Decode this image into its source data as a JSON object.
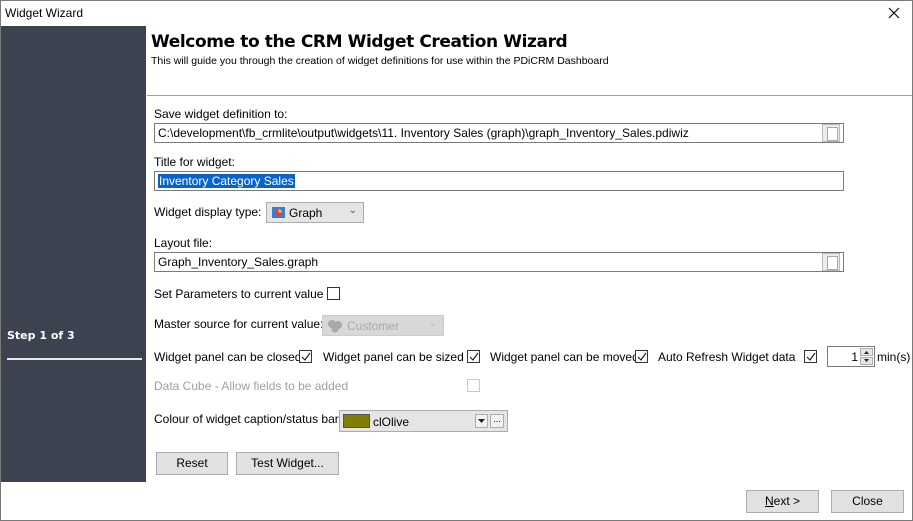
{
  "window": {
    "title": "Widget Wizard",
    "close_icon": "close-x-icon"
  },
  "sidebar": {
    "step_text": "Step 1 of 3"
  },
  "header": {
    "title": "Welcome to the CRM Widget Creation Wizard",
    "subtitle": "This will guide you through the creation of widget definitions for use within the PDiCRM Dashboard"
  },
  "form": {
    "save_definition": {
      "label": "Save widget definition to:",
      "value": "C:\\development\\fb_crmlite\\output\\widgets\\11. Inventory Sales (graph)\\graph_Inventory_Sales.pdiwiz",
      "browse_icon": "document-icon"
    },
    "title": {
      "label": "Title for widget:",
      "value": "Inventory Category Sales"
    },
    "display_type": {
      "label": "Widget display type:",
      "value": "Graph",
      "icon": "graph-icon"
    },
    "layout_file": {
      "label": "Layout file:",
      "value": "Graph_Inventory_Sales.graph",
      "browse_icon": "document-icon"
    },
    "set_parameters": {
      "label": "Set Parameters to current value",
      "checked": false
    },
    "master_source": {
      "label": "Master source for current value:",
      "value": "Customer",
      "enabled": false
    },
    "can_be_closed": {
      "label": "Widget panel can be closed",
      "checked": true
    },
    "can_be_sized": {
      "label": "Widget panel can be sized",
      "checked": true
    },
    "can_be_moved": {
      "label": "Widget panel can be moved",
      "checked": true
    },
    "auto_refresh": {
      "label": "Auto Refresh Widget data",
      "checked": true,
      "interval": "1",
      "unit": "min(s)"
    },
    "data_cube": {
      "label": "Data Cube - Allow fields to be added",
      "checked": false,
      "enabled": false
    },
    "caption_colour": {
      "label": "Colour of widget caption/status bar:",
      "value": "clOlive",
      "swatch": "#808000",
      "more_label": "..."
    }
  },
  "buttons": {
    "reset": "Reset",
    "test_widget": "Test Widget...",
    "next": "Next >",
    "close": "Close"
  },
  "colors": {
    "sidebar_bg": "#3d4250",
    "selection": "#0a64c8",
    "olive": "#808000"
  }
}
